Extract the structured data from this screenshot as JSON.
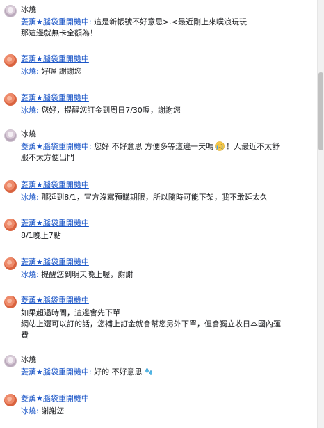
{
  "users": {
    "bingyao": "冰燒",
    "lingxun": "菱薰★腦袋重開機中"
  },
  "messages": [
    {
      "sender": "冰燒",
      "sender_is_link": false,
      "lines": [
        {
          "quote": "菱薰★腦袋重開機中:",
          "text": " 這是新帳號不好意思>.<最近剛上來噗浪玩玩"
        },
        {
          "quote": "",
          "text": "那這邊就無卡全額為！"
        }
      ]
    },
    {
      "sender": "菱薰★腦袋重開機中",
      "sender_is_link": true,
      "lines": [
        {
          "quote": "冰燒:",
          "text": " 好喔 謝謝您"
        }
      ]
    },
    {
      "sender": "菱薰★腦袋重開機中",
      "sender_is_link": true,
      "lines": [
        {
          "quote": "冰燒:",
          "text": " 您好，提醒您訂金到周日7/30喔，謝謝您"
        }
      ]
    },
    {
      "sender": "冰燒",
      "sender_is_link": false,
      "lines": [
        {
          "quote": "菱薰★腦袋重開機中:",
          "text": " 您好 不好意思 方便多等這邊一天嗎",
          "emoji": "crying-face-emoji",
          "after": "！人最近不太舒"
        },
        {
          "quote": "",
          "text": "服不太方便出門"
        }
      ]
    },
    {
      "sender": "菱薰★腦袋重開機中",
      "sender_is_link": true,
      "lines": [
        {
          "quote": "冰燒:",
          "text": " 那延到8/1，官方沒寫預購期限，所以隨時可能下架，我不敢延太久"
        }
      ]
    },
    {
      "sender": "菱薰★腦袋重開機中",
      "sender_is_link": true,
      "lines": [
        {
          "quote": "",
          "text": "8/1晚上7點"
        }
      ]
    },
    {
      "sender": "菱薰★腦袋重開機中",
      "sender_is_link": true,
      "lines": [
        {
          "quote": "冰燒:",
          "text": " 提醒您到明天晚上喔，謝謝"
        }
      ]
    },
    {
      "sender": "菱薰★腦袋重開機中",
      "sender_is_link": true,
      "lines": [
        {
          "quote": "",
          "text": "如果超過時間，這邊會先下單"
        },
        {
          "quote": "",
          "text": "網站上還可以訂的話，您補上訂金就會幫您另外下單，但會獨立收日本國內運"
        },
        {
          "quote": "",
          "text": "費"
        }
      ]
    },
    {
      "sender": "冰燒",
      "sender_is_link": false,
      "lines": [
        {
          "quote": "菱薰★腦袋重開機中:",
          "text": " 好的 不好意思",
          "emoji": "sweat-drops-emoji",
          "after": ""
        }
      ]
    },
    {
      "sender": "菱薰★腦袋重開機中",
      "sender_is_link": true,
      "lines": [
        {
          "quote": "冰燒:",
          "text": " 謝謝您"
        }
      ]
    }
  ],
  "colors": {
    "link": "#1a55c7",
    "text": "#1c1e21",
    "background": "#ffffff"
  }
}
